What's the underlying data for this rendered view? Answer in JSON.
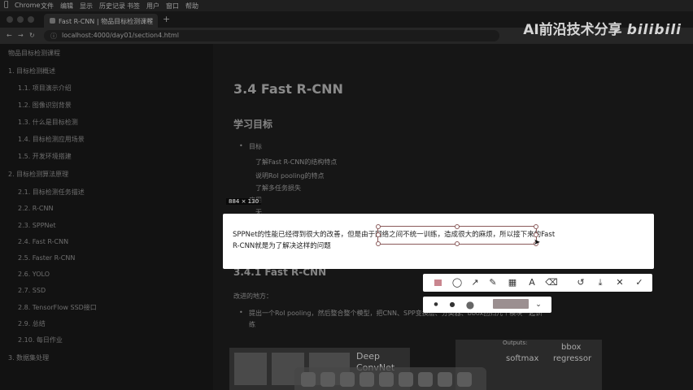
{
  "menubar": {
    "app": "Chrome",
    "menus": [
      "文件",
      "编辑",
      "显示",
      "历史记录",
      "书签",
      "用户",
      "窗口",
      "帮助"
    ]
  },
  "tab": {
    "title": "Fast R-CNN | 物品目标检测课程"
  },
  "address": {
    "url": "localhost:4000/day01/section4.html"
  },
  "watermark": {
    "text": "AI前沿技术分享",
    "logo": "bilibili"
  },
  "sidebar": {
    "items": [
      "物品目标检测课程",
      "1. 目标检测概述",
      "1.1. 项目演示介绍",
      "1.2. 图像识别背景",
      "1.3. 什么是目标检测",
      "1.4. 目标检测应用场景",
      "1.5. 开发环境搭建",
      "2. 目标检测算法原理",
      "2.1. 目标检测任务描述",
      "2.2. R-CNN",
      "2.3. SPPNet",
      "2.4. Fast R-CNN",
      "2.5. Faster R-CNN",
      "2.6. YOLO",
      "2.7. SSD",
      "2.8. TensorFlow SSD接口",
      "2.9. 总结",
      "2.10. 每日作业",
      "3. 数据集处理"
    ]
  },
  "content": {
    "title": "3.4 Fast R-CNN",
    "section_goals": "学习目标",
    "goal_label": "目标",
    "goals": [
      "了解Fast R-CNN的结构特点",
      "说明RoI pooling的特点",
      "了解多任务损失"
    ],
    "apply_label": "应用",
    "apply_value": "无",
    "section2": "3.4.1 Fast R-CNN",
    "improve_label": "改进的地方：",
    "improve_item": "提出一个RoI pooling，然后整合整个模型，把CNN、SPP变换层、分类器、bbox回归几个模块一起训",
    "improve_item_cont": "练",
    "figure_left": [
      "Deep",
      "ConvNet"
    ],
    "figure_right": [
      "Outputs:",
      "bbox",
      "softmax",
      "regressor"
    ]
  },
  "selection": {
    "size_label": "884 × 130",
    "line1": "SPPNet的性能已经得到很大的改善，但是由于网络之间不统一训练，造成很大的麻烦，所以接下来的Fast",
    "line2": "R-CNN就是为了解决这样的问题"
  },
  "toolbar": {
    "tools": [
      "rectangle-icon",
      "ellipse-icon",
      "arrow-icon",
      "pen-icon",
      "mosaic-icon",
      "text-icon",
      "eraser-icon",
      "undo-icon",
      "download-icon",
      "close-icon",
      "confirm-icon"
    ],
    "accent": "#c9868f"
  }
}
